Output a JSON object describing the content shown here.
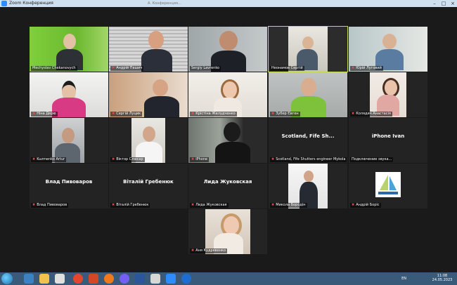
{
  "window": {
    "title": "Zoom Конференция",
    "subtitle": "А. Конференция…"
  },
  "tiles": [
    {
      "name": "Mechyslav Chekanovych"
    },
    {
      "name": "Андрій Пашич"
    },
    {
      "name": "Sergiy Lavrenko"
    },
    {
      "name": "Неонамов Сергій"
    },
    {
      "name": "Юрій Луговий"
    },
    {
      "name": "Ніна Дерю"
    },
    {
      "name": "Сергій Луцик"
    },
    {
      "name": "Крістіна Желудченко"
    },
    {
      "name": "Зубер Євген"
    },
    {
      "name": "Колядич Анастасія"
    },
    {
      "name": "Kuzmenko Artur"
    },
    {
      "name": "Віктор Слюсар"
    },
    {
      "name": "iPhone"
    },
    {
      "name": "Scotland, Fife Shutters engineer Mykola",
      "big": "Scotland, Fife Sh..."
    },
    {
      "name": "Подключение звука...",
      "big": "iPhone Ivan"
    },
    {
      "name": "Влад Пивоваров",
      "big": "Влад Пивоваров"
    },
    {
      "name": "Віталій Гребенюк",
      "big": "Віталій Гребенюк"
    },
    {
      "name": "Лида Жуковская",
      "big": "Лида Жуковская"
    },
    {
      "name": "Микола Бородін"
    },
    {
      "name": "Андрій Боріс"
    },
    {
      "name": "Аня Кудрявенко"
    }
  ],
  "tray": {
    "lang": "EN",
    "time": "11:08",
    "date": "24.05.2023"
  },
  "colors": {
    "background": "#1a1a1a",
    "active_border": "#c8d850",
    "mute": "#e05050"
  }
}
